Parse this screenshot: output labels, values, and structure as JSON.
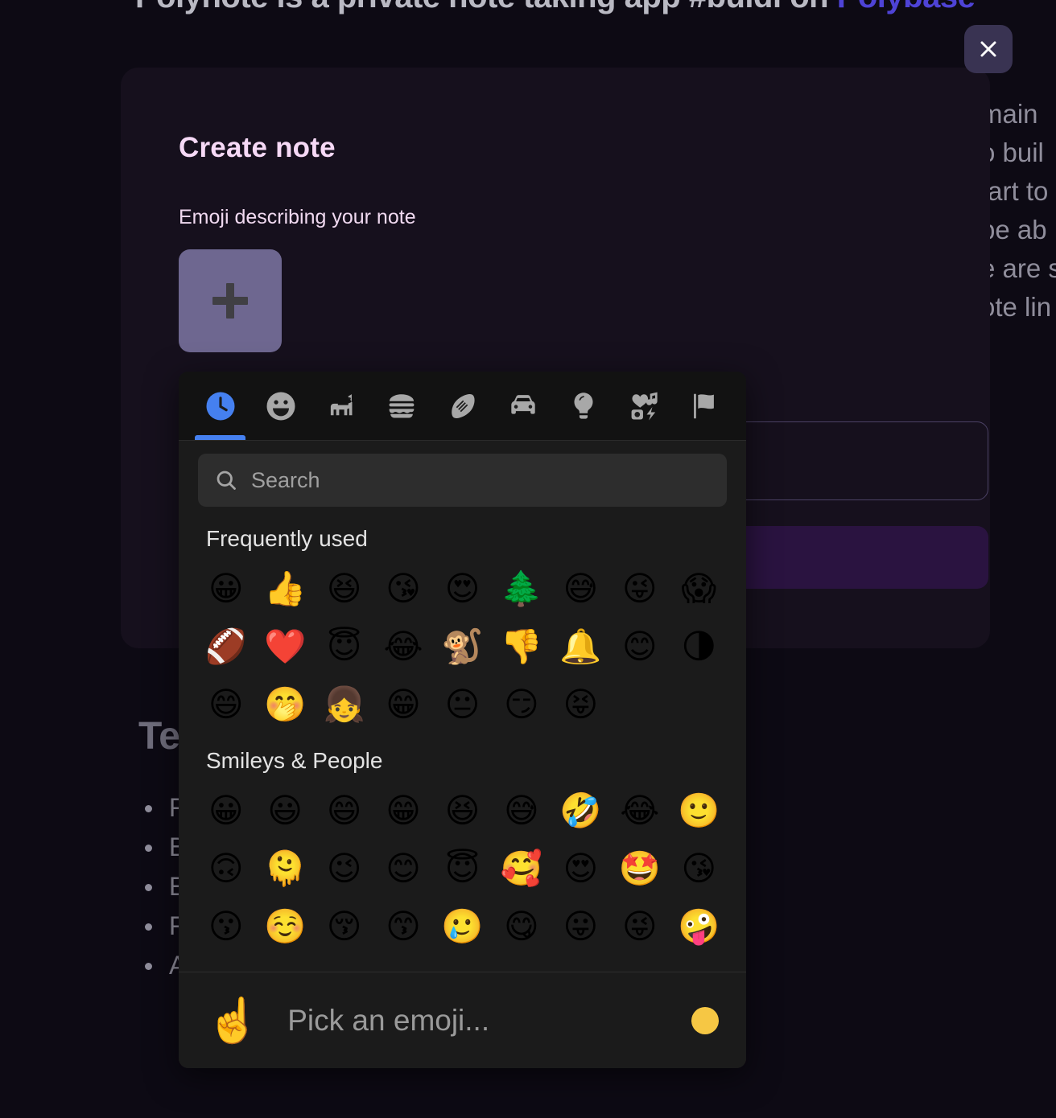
{
  "background": {
    "headline_prefix": "Polynote is a private note taking app #buidl on ",
    "headline_brand": "Polybase",
    "paragraph_lines": [
      "main",
      "o buil",
      "tart to",
      "be ab",
      "e are s",
      "ote lin"
    ],
    "section_title": "Te",
    "list_items": [
      "F",
      "B",
      "E",
      "F",
      "A"
    ]
  },
  "modal": {
    "title": "Create note",
    "emoji_field_label": "Emoji describing your note",
    "emoji_trigger_icon": "plus-icon",
    "close_icon": "close-icon"
  },
  "picker": {
    "tabs": [
      {
        "name": "recent",
        "icon": "clock-icon",
        "active": true
      },
      {
        "name": "smileys",
        "icon": "smiley-icon",
        "active": false
      },
      {
        "name": "animals",
        "icon": "dog-icon",
        "active": false
      },
      {
        "name": "food",
        "icon": "burger-icon",
        "active": false
      },
      {
        "name": "activities",
        "icon": "football-icon",
        "active": false
      },
      {
        "name": "travel",
        "icon": "car-icon",
        "active": false
      },
      {
        "name": "objects",
        "icon": "lightbulb-icon",
        "active": false
      },
      {
        "name": "symbols",
        "icon": "symbols-icon",
        "active": false
      },
      {
        "name": "flags",
        "icon": "flag-icon",
        "active": false
      }
    ],
    "search": {
      "icon": "search-icon",
      "placeholder": "Search",
      "value": ""
    },
    "groups": [
      {
        "title": "Frequently used",
        "emojis": [
          "😀",
          "👍",
          "😆",
          "😘",
          "😍",
          "🌲",
          "😅",
          "😜",
          "😱",
          "🏈",
          "❤️",
          "😇",
          "😂",
          "🐒",
          "👎",
          "🔔",
          "😊",
          "🌗",
          "😄",
          "🤭",
          "👧",
          "😁",
          "😐",
          "😏",
          "😝"
        ]
      },
      {
        "title": "Smileys & People",
        "emojis": [
          "😀",
          "😃",
          "😄",
          "😁",
          "😆",
          "😅",
          "🤣",
          "😂",
          "🙂",
          "🙃",
          "🫠",
          "😉",
          "😊",
          "😇",
          "🥰",
          "😍",
          "🤩",
          "😘",
          "😗",
          "☺️",
          "😚",
          "😙",
          "🥲",
          "😋",
          "😛",
          "😜",
          "🤪"
        ]
      }
    ],
    "preview": {
      "emoji": "☝️",
      "text": "Pick an emoji...",
      "skin_tone_name": "skin-tone-default"
    }
  },
  "colors": {
    "modal_bg": "#16101d",
    "picker_bg": "#1b1b1b",
    "accent_blue": "#4580f0",
    "title_pink": "#f6d9f6",
    "trigger_purple": "#6e6790",
    "brand_indigo": "#4e43d6"
  }
}
